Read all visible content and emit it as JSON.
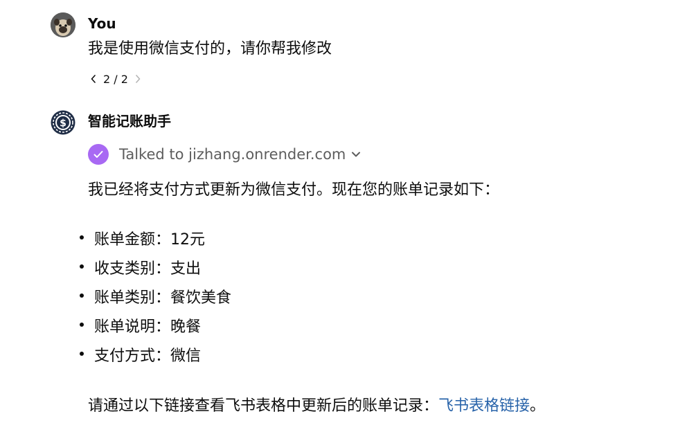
{
  "user": {
    "name": "You",
    "message": "我是使用微信支付的，请你帮我修改",
    "pager": {
      "text": "2 / 2"
    }
  },
  "assistant": {
    "name": "智能记账助手",
    "tool": {
      "label": "Talked to jizhang.onrender.com"
    },
    "intro": "我已经将支付方式更新为微信支付。现在您的账单记录如下：",
    "bullets": [
      "账单金额：12元",
      "收支类别：支出",
      "账单类别：餐饮美食",
      "账单说明：晚餐",
      "支付方式：微信"
    ],
    "outro_prefix": "请通过以下链接查看飞书表格中更新后的账单记录：",
    "outro_link": "飞书表格链接",
    "outro_suffix": "。"
  },
  "colors": {
    "check_badge": "#a869f3",
    "link": "#2964aa",
    "bot_avatar": "#1f2d46"
  }
}
